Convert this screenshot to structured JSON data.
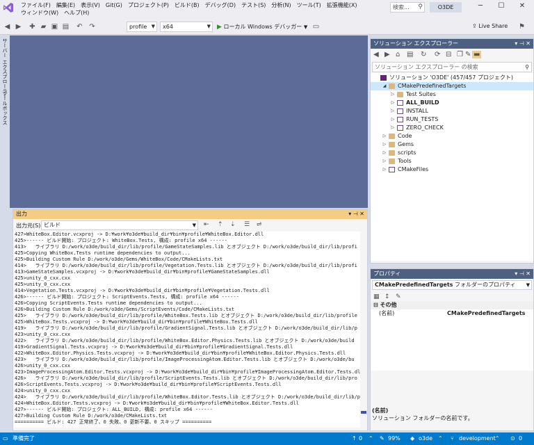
{
  "menu": {
    "items": [
      "ファイル(F)",
      "編集(E)",
      "表示(V)",
      "Git(G)",
      "プロジェクト(P)",
      "ビルド(B)",
      "デバッグ(D)",
      "テスト(S)",
      "分析(N)",
      "ツール(T)",
      "拡張機能(X)",
      "ウィンドウ(W)",
      "ヘルプ(H)"
    ],
    "search_placeholder": "検索...",
    "project_name": "O3DE"
  },
  "toolbar": {
    "config": "profile",
    "platform": "x64",
    "run_label": "ローカル Windows デバッガー",
    "live_share": "Live Share"
  },
  "left_tabs": {
    "server_explorer": "サーバー エクスプローラー",
    "toolbox": "ツールボックス"
  },
  "output": {
    "title": "出力",
    "source_label": "出力元(S):",
    "source_value": "ビルド",
    "lines": [
      "427>WhiteBox.Editor.vcxproj -> D:¥work¥o3de¥build_dir¥bin¥profile¥WhiteBox.Editor.dll",
      "425>------ ビルド開始: プロジェクト: WhiteBox.Tests, 構成: profile x64 ------",
      "413>   ライブラリ D:/work/o3de/build_dir/lib/profile/GameStateSamples.lib とオブジェクト D:/work/o3de/build_dir/lib/profi",
      "425>Copying WhiteBox.Tests runtime dependencies to output...",
      "425>Building Custom Rule D:/work/o3de/Gems/WhiteBox/Code/CMakeLists.txt",
      "414>   ライブラリ D:/work/o3de/build_dir/lib/profile/Vegetation.Tests.lib とオブジェクト D:/work/o3de/build_dir/lib/profi",
      "413>GameStateSamples.vcxproj -> D:¥work¥o3de¥build_dir¥bin¥profile¥GameStateSamples.dll",
      "425>unity_0_cxx.cxx",
      "425>unity_0_cxx.cxx",
      "414>Vegetation.Tests.vcxproj -> D:¥work¥o3de¥build_dir¥bin¥profile¥Vegetation.Tests.dll",
      "426>------ ビルド開始: プロジェクト: ScriptEvents.Tests, 構成: profile x64 ------",
      "426>Copying ScriptEvents.Tests runtime dependencies to output...",
      "426>Building Custom Rule D:/work/o3de/Gems/ScriptEvents/Code/CMakeLists.txt",
      "425>   ライブラリ D:/work/o3de/build_dir/lib/profile/WhiteBox.Tests.lib とオブジェクト D:/work/o3de/build_dir/lib/profile",
      "425>WhiteBox.Tests.vcxproj -> D:¥work¥o3de¥build_dir¥bin¥profile¥WhiteBox.Tests.dll",
      "419>   ライブラリ D:/work/o3de/build_dir/lib/profile/GradientSignal.Tests.lib とオブジェクト D:/work/o3de/build_dir/lib/p",
      "423>unity_0_cxx.cxx",
      "422>   ライブラリ D:/work/o3de/build_dir/lib/profile/WhiteBox.Editor.Physics.Tests.lib とオブジェクト D:/work/o3de/build",
      "419>GradientSignal.Tests.vcxproj -> D:¥work¥o3de¥build_dir¥bin¥profile¥GradientSignal.Tests.dll",
      "422>WhiteBox.Editor.Physics.Tests.vcxproj -> D:¥work¥o3de¥build_dir¥bin¥profile¥WhiteBox.Editor.Physics.Tests.dll",
      "423>   ライブラリ D:/work/o3de/build_dir/lib/profile/ImageProcessingAtom.Editor.Tests.lib とオブジェクト D:/work/o3de/bu",
      "426>unity_0_cxx.cxx",
      "423>ImageProcessingAtom.Editor.Tests.vcxproj -> D:¥work¥o3de¥build_dir¥bin¥profile¥ImageProcessingAtom.Editor.Tests.dll",
      "426>   ライブラリ D:/work/o3de/build_dir/lib/profile/ScriptEvents.Tests.lib とオブジェクト D:/work/o3de/build_dir/lib/pro",
      "426>ScriptEvents.Tests.vcxproj -> D:¥work¥o3de¥build_dir¥bin¥profile¥ScriptEvents.Tests.dll",
      "424>unity_0_cxx.cxx",
      "424>   ライブラリ D:/work/o3de/build_dir/lib/profile/WhiteBox.Editor.Tests.lib とオブジェクト D:/work/o3de/build_dir/lib/profi",
      "424>WhiteBox.Editor.Tests.vcxproj -> D:¥work¥o3de¥build_dir¥bin¥profile¥WhiteBox.Editor.Tests.dll",
      "427>------ ビルド開始: プロジェクト: ALL_BUILD, 構成: profile x64 ------",
      "427>Building Custom Rule D:/work/o3de/CMakeLists.txt",
      "========== ビルド: 427 正常終了、0 失敗、0 更新不要、0 スキップ =========="
    ]
  },
  "solution_explorer": {
    "title": "ソリューション エクスプローラー",
    "search_placeholder": "ソリューション エクスプローラー の検索",
    "nodes": [
      {
        "label": "ソリューション 'O3DE' (457/457 プロジェクト)",
        "icon": "solution-icon",
        "expander": ""
      },
      {
        "label": "CMakePredefinedTargets",
        "icon": "folder-open-icon",
        "expander": "◢"
      },
      {
        "label": "Test Suites",
        "icon": "folder-icon",
        "expander": "▷"
      },
      {
        "label": "ALL_BUILD",
        "icon": "cmake-project-icon",
        "expander": "▷"
      },
      {
        "label": "INSTALL",
        "icon": "cmake-project-icon",
        "expander": "▷"
      },
      {
        "label": "RUN_TESTS",
        "icon": "cmake-project-icon",
        "expander": "▷"
      },
      {
        "label": "ZERO_CHECK",
        "icon": "cmake-project-icon",
        "expander": "▷"
      },
      {
        "label": "Code",
        "icon": "folder-icon",
        "expander": "▷"
      },
      {
        "label": "Gems",
        "icon": "folder-icon",
        "expander": "▷"
      },
      {
        "label": "scripts",
        "icon": "folder-icon",
        "expander": "▷"
      },
      {
        "label": "Tools",
        "icon": "folder-icon",
        "expander": "▷"
      },
      {
        "label": "CMakeFiles",
        "icon": "cmake-project-icon",
        "expander": "▷"
      }
    ]
  },
  "properties": {
    "title": "プロパティ",
    "object_name": "CMakePredefinedTargets",
    "object_type": "フォルダーのプロパティ",
    "category": "その他",
    "row_key": "(名前)",
    "row_value": "CMakePredefinedTargets",
    "desc_title": "(名前)",
    "desc_text": "ソリューション フォルダーの名前です。"
  },
  "status": {
    "ready": "準備完了",
    "up_count": "0",
    "zoom": "99%",
    "repo": "o3de",
    "branch": "development",
    "changes": "0"
  },
  "colors": {
    "accent": "#007acc",
    "editor_bg": "#5d6b99",
    "active_title": "#f5cc84",
    "inactive_title": "#4d6082"
  }
}
